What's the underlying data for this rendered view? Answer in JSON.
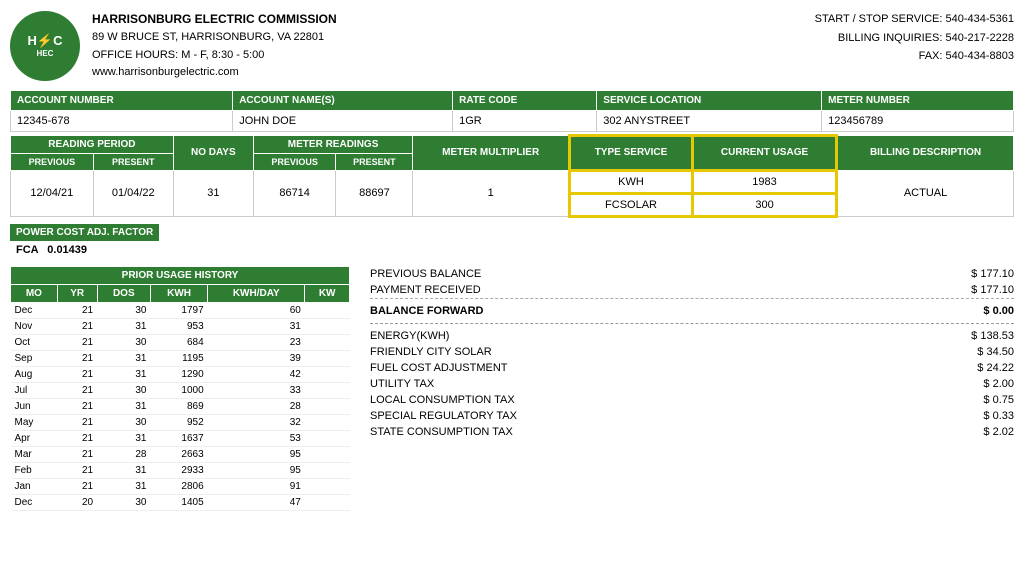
{
  "company": {
    "logo_text": "H&C",
    "name": "HARRISONBURG ELECTRIC COMMISSION",
    "address1": "89 W BRUCE ST, HARRISONBURG, VA 22801",
    "hours": "OFFICE HOURS: M - F, 8:30 - 5:00",
    "website": "www.harrisonburgelectric.com"
  },
  "contact": {
    "start_stop": "START / STOP SERVICE: 540-434-5361",
    "billing": "BILLING INQUIRIES: 540-217-2228",
    "fax": "FAX: 540-434-8803"
  },
  "account": {
    "number_label": "ACCOUNT NUMBER",
    "name_label": "ACCOUNT NAME(S)",
    "rate_label": "RATE CODE",
    "location_label": "SERVICE LOCATION",
    "meter_label": "METER NUMBER",
    "number": "12345-678",
    "name": "JOHN DOE",
    "rate": "1GR",
    "location": "302 ANYSTREET",
    "meter": "123456789"
  },
  "readings": {
    "headers": {
      "reading_period": "READING PERIOD",
      "previous_period": "PREVIOUS",
      "present_period": "PRESENT",
      "no_days": "NO DAYS",
      "meter_readings": "METER READINGS",
      "meter_previous": "PREVIOUS",
      "meter_present": "PRESENT",
      "meter_multiplier": "METER MULTIPLIER",
      "type_service": "TYPE SERVICE",
      "current_usage": "CURRENT USAGE",
      "billing_description": "BILLING DESCRIPTION"
    },
    "data": {
      "previous": "12/04/21",
      "present": "01/04/22",
      "no_days": "31",
      "meter_previous": "86714",
      "meter_present": "88697",
      "multiplier": "1",
      "type_service1": "KWH",
      "type_service2": "FCSOLAR",
      "current_usage1": "1983",
      "current_usage2": "300",
      "billing_desc": "ACTUAL"
    }
  },
  "power_cost": {
    "header": "POWER COST ADJ. FACTOR",
    "label": "FCA",
    "value": "0.01439"
  },
  "prior_usage": {
    "header": "PRIOR USAGE HISTORY",
    "columns": [
      "MO",
      "YR",
      "DOS",
      "KWH",
      "KWH/DAY",
      "KW"
    ],
    "rows": [
      [
        "Dec",
        "21",
        "30",
        "1797",
        "60",
        ""
      ],
      [
        "Nov",
        "21",
        "31",
        "953",
        "31",
        ""
      ],
      [
        "Oct",
        "21",
        "30",
        "684",
        "23",
        ""
      ],
      [
        "Sep",
        "21",
        "31",
        "1195",
        "39",
        ""
      ],
      [
        "Aug",
        "21",
        "31",
        "1290",
        "42",
        ""
      ],
      [
        "Jul",
        "21",
        "30",
        "1000",
        "33",
        ""
      ],
      [
        "Jun",
        "21",
        "31",
        "869",
        "28",
        ""
      ],
      [
        "May",
        "21",
        "30",
        "952",
        "32",
        ""
      ],
      [
        "Apr",
        "21",
        "31",
        "1637",
        "53",
        ""
      ],
      [
        "Mar",
        "21",
        "28",
        "2663",
        "95",
        ""
      ],
      [
        "Feb",
        "21",
        "31",
        "2933",
        "95",
        ""
      ],
      [
        "Jan",
        "21",
        "31",
        "2806",
        "91",
        ""
      ],
      [
        "Dec",
        "20",
        "30",
        "1405",
        "47",
        ""
      ]
    ]
  },
  "billing": {
    "previous_balance_label": "PREVIOUS BALANCE",
    "previous_balance": "$ 177.10",
    "payment_received_label": "PAYMENT RECEIVED",
    "payment_received": "$ 177.10",
    "balance_forward_label": "BALANCE FORWARD",
    "balance_forward": "$ 0.00",
    "energy_label": "ENERGY(KWH)",
    "energy": "$ 138.53",
    "solar_label": "FRIENDLY CITY SOLAR",
    "solar": "$ 34.50",
    "fuel_label": "FUEL COST ADJUSTMENT",
    "fuel": "$ 24.22",
    "utility_label": "UTILITY TAX",
    "utility": "$ 2.00",
    "local_label": "LOCAL CONSUMPTION TAX",
    "local": "$ 0.75",
    "special_label": "SPECIAL REGULATORY TAX",
    "special": "$ 0.33",
    "state_label": "STATE CONSUMPTION TAX",
    "state": "$ 2.02"
  }
}
